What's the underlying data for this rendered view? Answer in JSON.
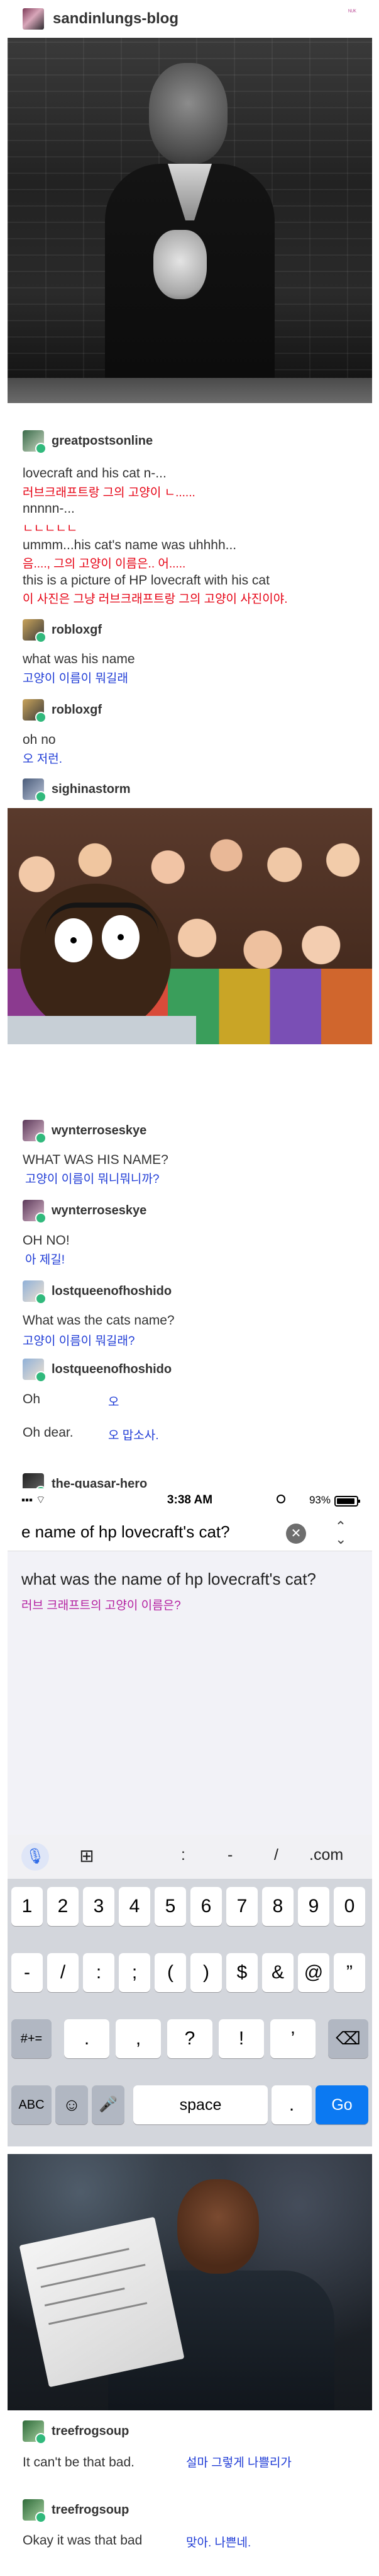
{
  "header": {
    "blog_name": "sandinlungs-blog",
    "corner_mark": "ᴺᵁᴷ"
  },
  "images": {
    "lovecraft_photo": "HP Lovecraft with his cat (black and white)",
    "south_park_photo": "South Park crowd scene",
    "jimmy_butler_photo": "Man in suit reading a paper"
  },
  "posts": [
    {
      "user": "greatpostsonline",
      "lines": [
        {
          "text": "lovecraft and his cat n-...",
          "ko": "러브크래프트랑 그의 고양이 ㄴ......"
        },
        {
          "text": "nnnnn-...",
          "ko": "ㄴㄴㄴㄴㄴ"
        },
        {
          "text": "ummm...his cat's name was uhhhh...",
          "ko": "음...., 그의 고양이 이름은.. 어....."
        },
        {
          "text": "this is a picture of HP lovecraft with his cat",
          "ko": "이 사진은 그냥 러브크래프트랑 그의 고양이 사진이야."
        }
      ]
    },
    {
      "user": "robloxgf",
      "text": "what was his name",
      "ko": "고양이 이름이 뭐길래"
    },
    {
      "user": "robloxgf",
      "text": "oh no",
      "ko": "오 저런."
    },
    {
      "user": "sighinastorm"
    },
    {
      "user": "wynterroseskye",
      "text": "WHAT WAS HIS NAME?",
      "ko": "고양이 이름이 뭐니뭐니까?"
    },
    {
      "user": "wynterroseskye",
      "text": "OH NO!",
      "ko": "아 제길!"
    },
    {
      "user": "lostqueenofhoshido",
      "text": "What was the cats name?",
      "ko": "고양이 이름이 뭐길래?"
    },
    {
      "user": "lostqueenofhoshido",
      "text": "Oh",
      "ko": "오",
      "text2": "Oh dear.",
      "ko2": "오 맙소사."
    },
    {
      "user": "the-quasar-hero"
    }
  ],
  "phone": {
    "time": "3:38 AM",
    "battery": "93%",
    "search_value": "e name of hp lovecraft's cat?",
    "clear_glyph": "✕",
    "collapse_glyph": "⌃",
    "suggestion": "what was the name of hp lovecraft's cat?",
    "suggestion_ko": "러브 크래프트의 고양이 이름은?",
    "toolbar_keys": [
      ":",
      "-",
      "/",
      ".com"
    ],
    "row1": [
      "1",
      "2",
      "3",
      "4",
      "5",
      "6",
      "7",
      "8",
      "9",
      "0"
    ],
    "row2": [
      "-",
      "/",
      ":",
      ";",
      "(",
      ")",
      "$",
      "&",
      "@",
      "”"
    ],
    "row3_left": "#+=",
    "row3": [
      ".",
      ",",
      "?",
      "!",
      "’"
    ],
    "row3_right": "⌫",
    "row4": {
      "abc": "ABC",
      "emoji": "☺",
      "mic": "🎤",
      "space": "space",
      "dot": ".",
      "go": "Go"
    }
  },
  "replies": [
    {
      "user": "treefrogsoup",
      "text": "It can't be that bad.",
      "ko": "설마 그렇게 나쁠리가"
    },
    {
      "user": "treefrogsoup",
      "text": "Okay it was that bad",
      "ko": "맞아. 나쁜네."
    }
  ]
}
